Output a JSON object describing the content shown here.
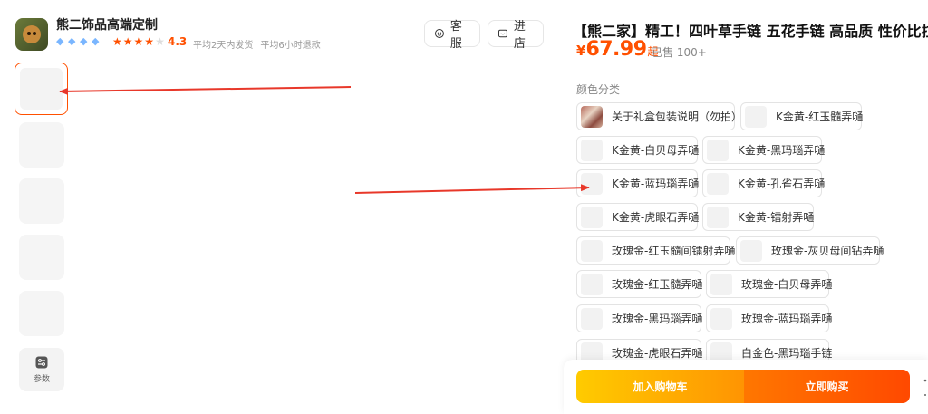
{
  "store": {
    "name": "熊二饰品高端定制",
    "rating": "4.3",
    "meta": [
      "平均2天内发货",
      "平均6小时退款"
    ],
    "diamond_count": 4,
    "stars_on": 4,
    "stars_total": 5
  },
  "header_buttons": {
    "service": "客服",
    "shop": "进店"
  },
  "sidebar": {
    "params_label": "参数"
  },
  "product": {
    "title": "【熊二家】精工！四叶草手链 五花手链 高品质 性价比拉",
    "price_currency": "¥",
    "price_value": "67.99",
    "price_suffix": "起",
    "sold": "已售 100+"
  },
  "color_section": {
    "label": "颜色分类",
    "options": [
      "关于礼盒包装说明（勿拍）",
      "K金黄-红玉髓弄嗵",
      "K金黄-白贝母弄嗵",
      "K金黄-黑玛瑙弄嗵",
      "K金黄-蓝玛瑙弄嗵",
      "K金黄-孔雀石弄嗵",
      "K金黄-虎眼石弄嗵",
      "K金黄-镭射弄嗵",
      "玫瑰金-红玉髓间镭射弄嗵",
      "玫瑰金-灰贝母间钻弄嗵",
      "玫瑰金-红玉髓弄嗵",
      "玫瑰金-白贝母弄嗵",
      "玫瑰金-黑玛瑙弄嗵",
      "玫瑰金-蓝玛瑙弄嗵",
      "玫瑰金-虎眼石弄嗵",
      "白金色-黑玛瑙手链"
    ]
  },
  "actions": {
    "add_to_cart": "加入购物车",
    "buy_now": "立即购买"
  },
  "colors": {
    "accent": "#ff5000",
    "arrow": "#e8382a",
    "cart_gradient": [
      "#ffcb00",
      "#ff9402"
    ],
    "buy_gradient": [
      "#ff7700",
      "#ff4900"
    ]
  }
}
